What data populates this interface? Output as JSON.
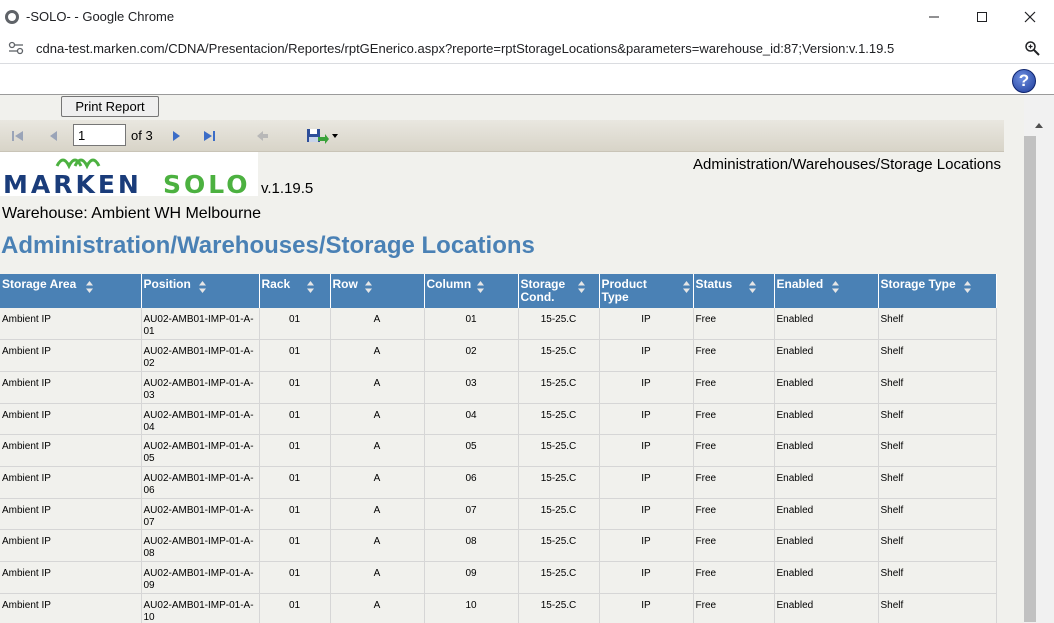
{
  "window": {
    "title": "-SOLO- - Google Chrome",
    "url": "cdna-test.marken.com/CDNA/Presentacion/Reportes/rptGEnerico.aspx?reporte=rptStorageLocations&parameters=warehouse_id:87;Version:v.1.19.5"
  },
  "controls": {
    "print_label": "Print Report",
    "page_value": "1",
    "page_of": "of 3"
  },
  "report": {
    "logo_part1": "MARKEN",
    "logo_part2": "SOLO",
    "version": "v.1.19.5",
    "path": "Administration/Warehouses/Storage Locations",
    "warehouse": "Warehouse: Ambient WH Melbourne",
    "title": "Administration/Warehouses/Storage Locations"
  },
  "table": {
    "headers": [
      "Storage Area",
      "Position",
      "Rack",
      "Row",
      "Column",
      "Storage Cond.",
      "Product Type",
      "Status",
      "Enabled",
      "Storage Type"
    ],
    "rows": [
      [
        "Ambient IP",
        "AU02-AMB01-IMP-01-A-01",
        "01",
        "A",
        "01",
        "15-25.C",
        "IP",
        "Free",
        "Enabled",
        "Shelf"
      ],
      [
        "Ambient IP",
        "AU02-AMB01-IMP-01-A-02",
        "01",
        "A",
        "02",
        "15-25.C",
        "IP",
        "Free",
        "Enabled",
        "Shelf"
      ],
      [
        "Ambient IP",
        "AU02-AMB01-IMP-01-A-03",
        "01",
        "A",
        "03",
        "15-25.C",
        "IP",
        "Free",
        "Enabled",
        "Shelf"
      ],
      [
        "Ambient IP",
        "AU02-AMB01-IMP-01-A-04",
        "01",
        "A",
        "04",
        "15-25.C",
        "IP",
        "Free",
        "Enabled",
        "Shelf"
      ],
      [
        "Ambient IP",
        "AU02-AMB01-IMP-01-A-05",
        "01",
        "A",
        "05",
        "15-25.C",
        "IP",
        "Free",
        "Enabled",
        "Shelf"
      ],
      [
        "Ambient IP",
        "AU02-AMB01-IMP-01-A-06",
        "01",
        "A",
        "06",
        "15-25.C",
        "IP",
        "Free",
        "Enabled",
        "Shelf"
      ],
      [
        "Ambient IP",
        "AU02-AMB01-IMP-01-A-07",
        "01",
        "A",
        "07",
        "15-25.C",
        "IP",
        "Free",
        "Enabled",
        "Shelf"
      ],
      [
        "Ambient IP",
        "AU02-AMB01-IMP-01-A-08",
        "01",
        "A",
        "08",
        "15-25.C",
        "IP",
        "Free",
        "Enabled",
        "Shelf"
      ],
      [
        "Ambient IP",
        "AU02-AMB01-IMP-01-A-09",
        "01",
        "A",
        "09",
        "15-25.C",
        "IP",
        "Free",
        "Enabled",
        "Shelf"
      ],
      [
        "Ambient IP",
        "AU02-AMB01-IMP-01-A-10",
        "01",
        "A",
        "10",
        "15-25.C",
        "IP",
        "Free",
        "Enabled",
        "Shelf"
      ]
    ]
  },
  "colors": {
    "header_bg": "#4a81b5",
    "title_color": "#4a81b5",
    "logo_blue": "#1a3c7a",
    "logo_green": "#4cb140"
  }
}
